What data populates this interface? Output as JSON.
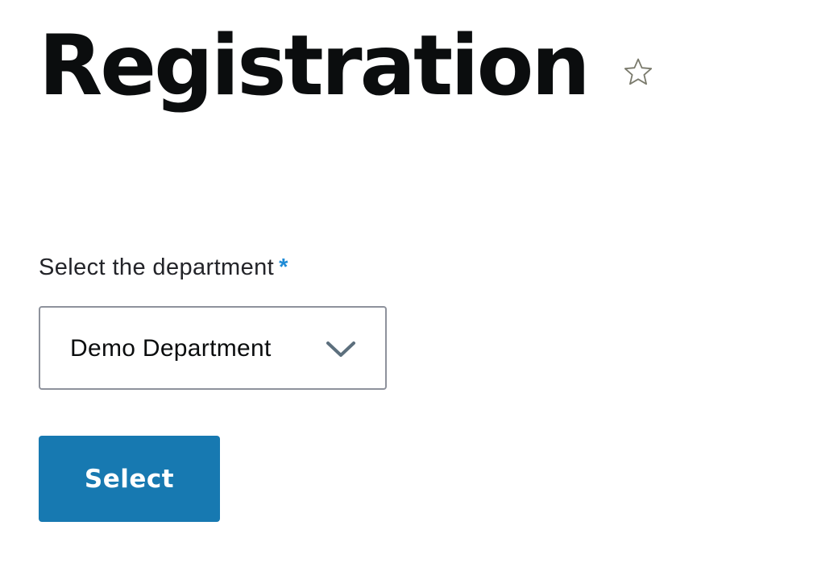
{
  "header": {
    "title": "Registration",
    "favorite_icon": "star-outline-icon"
  },
  "form": {
    "department_label": "Select the department",
    "required_marker": "*",
    "department_value": "Demo Department",
    "dropdown_icon": "chevron-down-icon",
    "submit_label": "Select"
  },
  "colors": {
    "title": "#0b0d0e",
    "label": "#232429",
    "required": "#1f8bd6",
    "select_border": "#8e929c",
    "chevron": "#5c6f7d",
    "star": "#7a7a6c",
    "button_bg": "#1779b1",
    "button_text": "#ffffff"
  }
}
